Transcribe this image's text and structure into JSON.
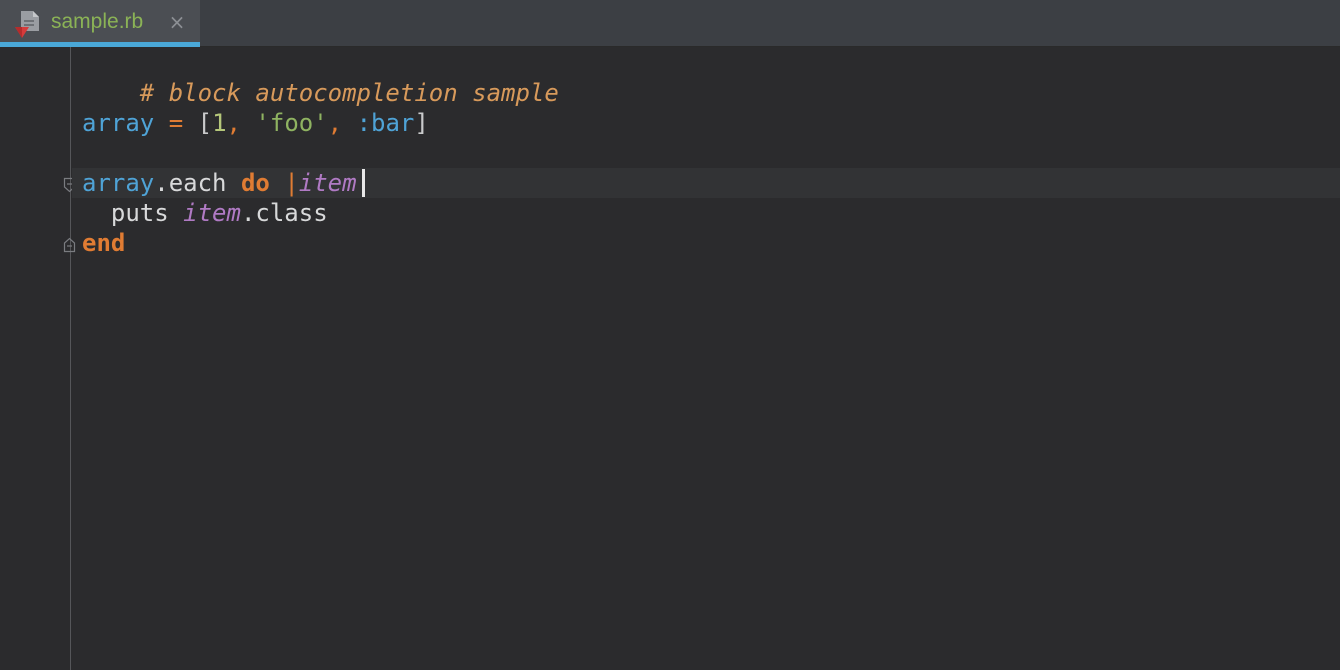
{
  "tab": {
    "label": "sample.rb",
    "close_glyph": "×",
    "icon": "ruby-file-icon"
  },
  "code": {
    "line1": {
      "comment": "# block autocompletion sample"
    },
    "line3": {
      "var": "array",
      "eq": " = ",
      "open": "[",
      "num": "1",
      "sep1": ", ",
      "str": "'foo'",
      "sep2": ", ",
      "sym": ":bar",
      "close": "]"
    },
    "line5": {
      "var": "array",
      "method": ".each ",
      "kw": "do",
      "space": " ",
      "pipe_open": "|",
      "param": "item",
      "pipe_close": "|"
    },
    "line6": {
      "indent": "  ",
      "call": "puts ",
      "param": "item",
      "method": ".class"
    },
    "line7": {
      "kw": "end"
    }
  },
  "colors": {
    "background": "#2b2b2d",
    "comment": "#d89a5b",
    "variable": "#4fa3d6",
    "keyword": "#e07c33",
    "string": "#8fb361",
    "number": "#b5c77a",
    "parameter": "#b07ac4",
    "tab_accent": "#4aa8d8",
    "tab_label": "#8bb356"
  }
}
